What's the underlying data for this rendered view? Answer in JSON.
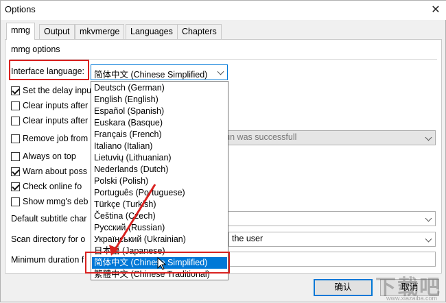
{
  "window": {
    "title": "Options"
  },
  "tabs": [
    "mmg",
    "Output",
    "mkvmerge",
    "Languages",
    "Chapters"
  ],
  "section_title": "mmg options",
  "interface_language": {
    "label": "Interface language:",
    "value": "简体中文 (Chinese Simplified)"
  },
  "checkboxes": [
    {
      "label": "Set the delay input",
      "checked": true
    },
    {
      "label": "Clear inputs after",
      "checked": false
    },
    {
      "label": "Clear inputs after",
      "checked": false
    },
    {
      "label": "Remove job from",
      "checked": false
    },
    {
      "label": "Always on top",
      "checked": false
    },
    {
      "label": "Warn about poss",
      "checked": true
    },
    {
      "label": "Check online fo",
      "checked": true
    },
    {
      "label": "Show mmg's deb",
      "checked": false
    }
  ],
  "remove_job_select": "run was successfull",
  "default_subtitle": {
    "label": "Default subtitle char",
    "value": ""
  },
  "scan_directory": {
    "label": "Scan directory for o",
    "value": "the user"
  },
  "minimum_duration": {
    "label": "Minimum duration f",
    "value": ""
  },
  "language_options": [
    "Deutsch (German)",
    "English (English)",
    "Español (Spanish)",
    "Euskara (Basque)",
    "Français (French)",
    "Italiano (Italian)",
    "Lietuvių (Lithuanian)",
    "Nederlands (Dutch)",
    "Polski (Polish)",
    "Português (Portuguese)",
    "Türkçe (Turkish)",
    "Čeština (Czech)",
    "Русский (Russian)",
    "Український (Ukrainian)",
    "日本語 (Japanese)",
    "简体中文 (Chinese Simplified)",
    "繁體中文 (Chinese Traditional)"
  ],
  "buttons": {
    "ok": "确认",
    "cancel": "取消"
  },
  "watermark": {
    "text": "下载吧",
    "sub": "www.xiazaiba.com"
  },
  "colors": {
    "accent": "#0078d7",
    "highlight_box": "#d9211f"
  }
}
